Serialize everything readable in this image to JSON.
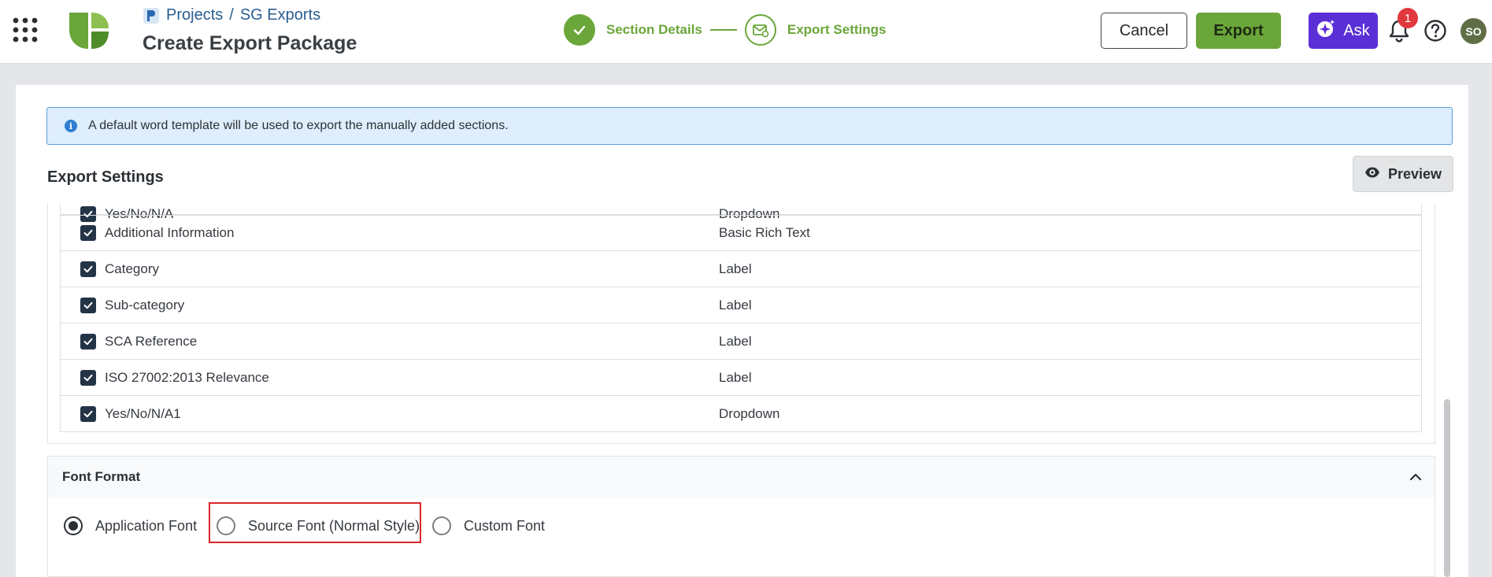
{
  "header": {
    "breadcrumb_projects": "Projects",
    "breadcrumb_sep": "/",
    "breadcrumb_current": "SG Exports",
    "page_title": "Create Export Package",
    "steps": [
      {
        "label": "Section Details",
        "state": "done"
      },
      {
        "label": "Export Settings",
        "state": "active"
      }
    ],
    "cancel_label": "Cancel",
    "export_label": "Export",
    "ask_label": "Ask",
    "notification_count": "1",
    "avatar_initials": "SO",
    "icons": [
      "apps-grid-icon",
      "brand-logo",
      "project-icon",
      "check-icon",
      "export-settings-icon",
      "sparkle-icon",
      "bell-icon",
      "help-icon"
    ]
  },
  "info_banner": {
    "text": "A default word template will be used to export the manually added sections."
  },
  "export_settings": {
    "title": "Export Settings",
    "preview_label": "Preview",
    "fields": [
      {
        "name": "Yes/No/N/A",
        "type": "Dropdown",
        "checked": true
      },
      {
        "name": "Additional Information",
        "type": "Basic Rich Text",
        "checked": true
      },
      {
        "name": "Category",
        "type": "Label",
        "checked": true
      },
      {
        "name": "Sub-category",
        "type": "Label",
        "checked": true
      },
      {
        "name": "SCA Reference",
        "type": "Label",
        "checked": true
      },
      {
        "name": "ISO 27002:2013 Relevance",
        "type": "Label",
        "checked": true
      },
      {
        "name": "Yes/No/N/A1",
        "type": "Dropdown",
        "checked": true
      }
    ]
  },
  "font_format": {
    "title": "Font Format",
    "options": [
      {
        "label": "Application Font",
        "selected": true
      },
      {
        "label": "Source Font (Normal Style)",
        "selected": false
      },
      {
        "label": "Custom Font",
        "selected": false
      }
    ]
  },
  "colors": {
    "brand_green": "#6ba63a",
    "ask_purple": "#5a2fd6",
    "badge_red": "#e0383e",
    "highlight_red": "#d9262a",
    "info_bg": "#deeefc"
  }
}
